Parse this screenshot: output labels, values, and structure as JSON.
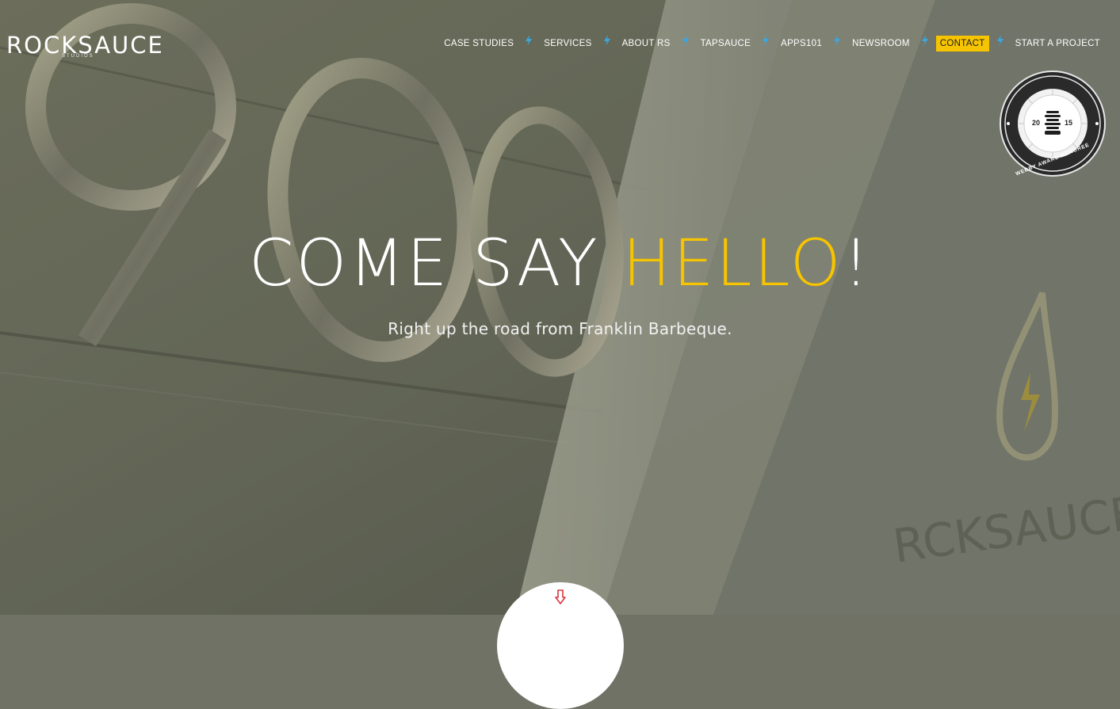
{
  "brand": {
    "logo_text": "ROCKSAUCE",
    "logo_subtext": "STUDIOS",
    "accent_color": "#f6c400",
    "separator_color": "#3ba7e0"
  },
  "nav": {
    "items": [
      {
        "label": "CASE STUDIES"
      },
      {
        "label": "SERVICES"
      },
      {
        "label": "ABOUT RS"
      },
      {
        "label": "TAPSAUCE"
      },
      {
        "label": "APPS101"
      },
      {
        "label": "NEWSROOM"
      },
      {
        "label": "CONTACT",
        "active": true
      },
      {
        "label": "START A PROJECT"
      }
    ],
    "separator_icon": "lightning-bolt-icon"
  },
  "award": {
    "year_left": "20",
    "year_right": "15",
    "caption": "WEBBY AWARD HONOREE"
  },
  "hero": {
    "headline_prefix": "COME SAY ",
    "headline_highlight": "HELLO",
    "headline_suffix": "!",
    "subheadline": "Right up the road from Franklin Barbeque."
  },
  "scroll_button": {
    "icon": "arrow-down-icon",
    "icon_color": "#d9363e"
  }
}
